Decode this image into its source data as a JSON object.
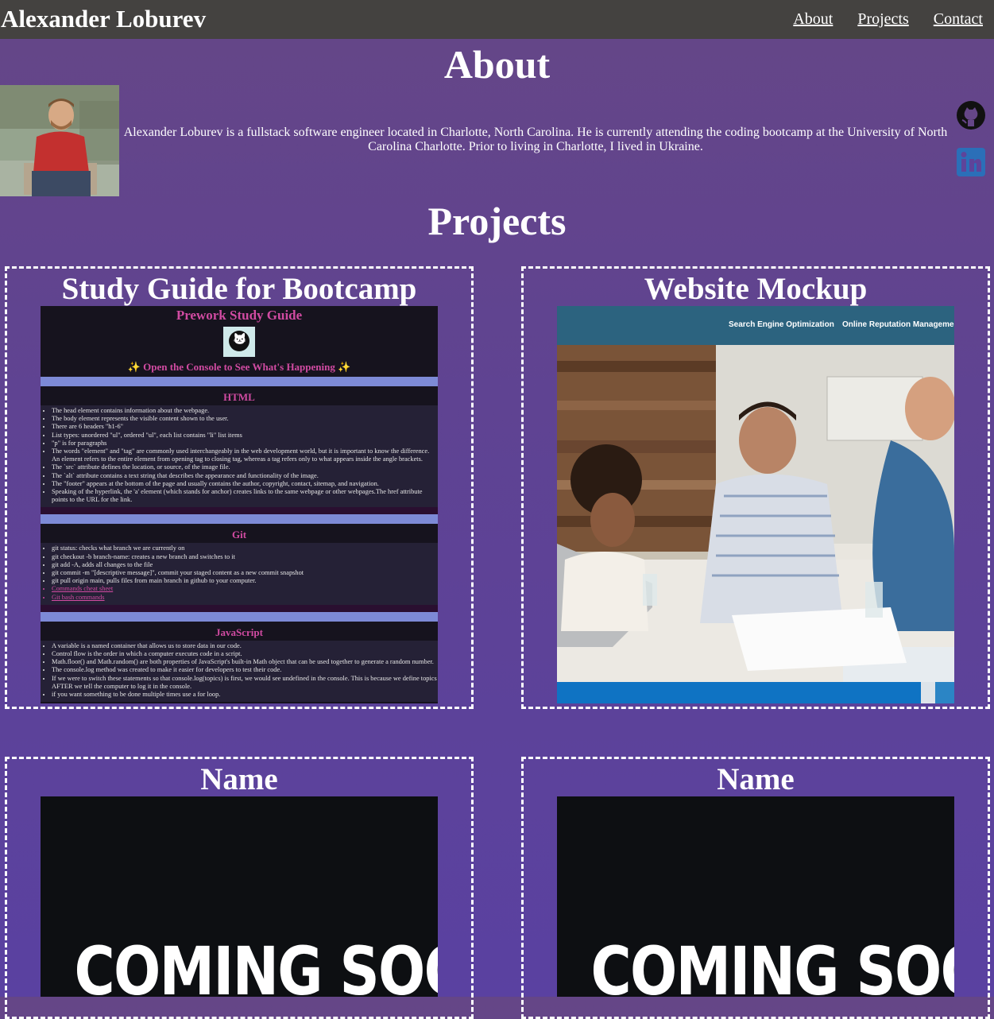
{
  "header": {
    "brand": "Alexander Loburev",
    "nav": [
      "About",
      "Projects",
      "Contact"
    ]
  },
  "about": {
    "title": "About",
    "bio": "Alexander Loburev is a fullstack software engineer located in Charlotte, North Carolina. He is currently attending the coding bootcamp at the University of North Carolina Charlotte. Prior to living in Charlotte, I lived in Ukraine.",
    "social": [
      "github-icon",
      "linkedin-icon"
    ]
  },
  "projects": {
    "title": "Projects",
    "cards": [
      {
        "title": "Study Guide for Bootcamp",
        "guide": {
          "heading": "Prework Study Guide",
          "console": "✨ Open the Console to See What's Happening ✨",
          "sections": [
            {
              "title": "HTML",
              "items": [
                "The head element contains information about the webpage.",
                "The body element represents the visible content shown to the user.",
                "There are 6 headers \"h1-6\"",
                "List types: unordered \"ul\", ordered \"ul\", each list contains \"li\" list items",
                "\"p\" is for paragraphs",
                "The words \"element\" and \"tag\" are commonly used interchangeably in the web development world, but it is important to know the difference. An element refers to the entire element from opening tag to closing tag, whereas a tag refers only to what appears inside the angle brackets.",
                "The `src` attribute defines the location, or source, of the image file.",
                "The `alt` attribute contains a text string that describes the appearance and functionality of the image.",
                "The \"footer\" appears at the bottom of the page and usually contains the author, copyright, contact, sitemap, and navigation.",
                "Speaking of the hyperlink, the 'a' element (which stands for anchor) creates links to the same webpage or other webpages.The href attribute points to the URL for the link."
              ]
            },
            {
              "title": "Git",
              "items": [
                "git status: checks what branch we are currently on",
                "git checkout -b branch-name: creates a new branch and switches to it",
                "git add -A, adds all changes to the file",
                "git commit -m \"[descriptive message]\", commit your staged content as a new commit snapshot",
                "git pull origin main, pulls files from main branch in github to your computer."
              ],
              "links": [
                "Commands cheat sheet",
                "Git bash commands"
              ]
            },
            {
              "title": "JavaScript",
              "items": [
                "A variable is a named container that allows us to store data in our code.",
                "Control flow is the order in which a computer executes code in a script.",
                "Math.floor() and Math.random() are both properties of JavaScript's built-in Math object that can be used together to generate a random number.",
                "The console.log method was created to make it easier for developers to test their code.",
                "If we were to switch these statements so that console.log(topics) is first, we would see undefined in the console. This is because we define topics AFTER we tell the computer to log it in the console.",
                "if you want something to be done multiple times use a for loop."
              ]
            }
          ]
        }
      },
      {
        "title": "Website Mockup",
        "mockup": {
          "nav": [
            "Search Engine Optimization",
            "Online Reputation Managemen"
          ]
        }
      },
      {
        "title": "Name",
        "image_text": "COMING SOON"
      },
      {
        "title": "Name",
        "image_text": "COMING SOON"
      }
    ]
  }
}
